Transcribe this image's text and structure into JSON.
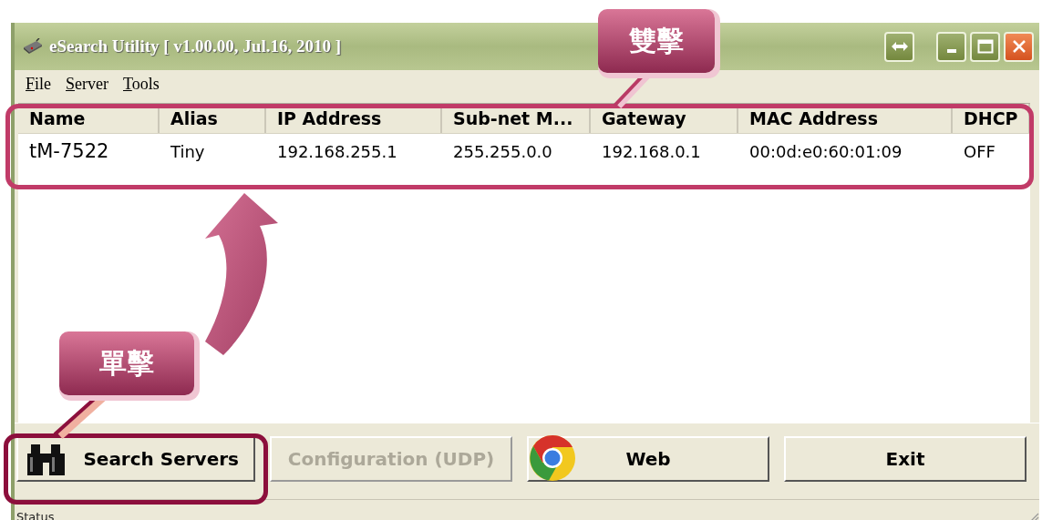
{
  "window": {
    "title": "eSearch Utility [ v1.00.00, Jul.16, 2010 ]"
  },
  "menu": [
    {
      "label": "File"
    },
    {
      "label": "Server"
    },
    {
      "label": "Tools"
    }
  ],
  "table": {
    "columns": [
      "Name",
      "Alias",
      "IP Address",
      "Sub-net M...",
      "Gateway",
      "MAC Address",
      "DHCP"
    ],
    "rows": [
      {
        "selected": false,
        "cells": [
          "tM-7522",
          "Tiny",
          "192.168.255.1",
          "255.255.0.0",
          "192.168.0.1",
          "00:0d:e0:60:01:09",
          "OFF"
        ]
      }
    ]
  },
  "buttons": [
    {
      "label": "Search Servers",
      "kind": "binoculars",
      "disabled": false
    },
    {
      "label": "Configuration (UDP)",
      "kind": "plain",
      "disabled": true
    },
    {
      "label": "Web",
      "kind": "browser",
      "disabled": false
    },
    {
      "label": "Exit",
      "kind": "plain",
      "disabled": false
    }
  ],
  "status_bar": {
    "text": "Status"
  },
  "annotations": [
    {
      "label": "雙擊"
    },
    {
      "label": "單擊"
    }
  ]
}
